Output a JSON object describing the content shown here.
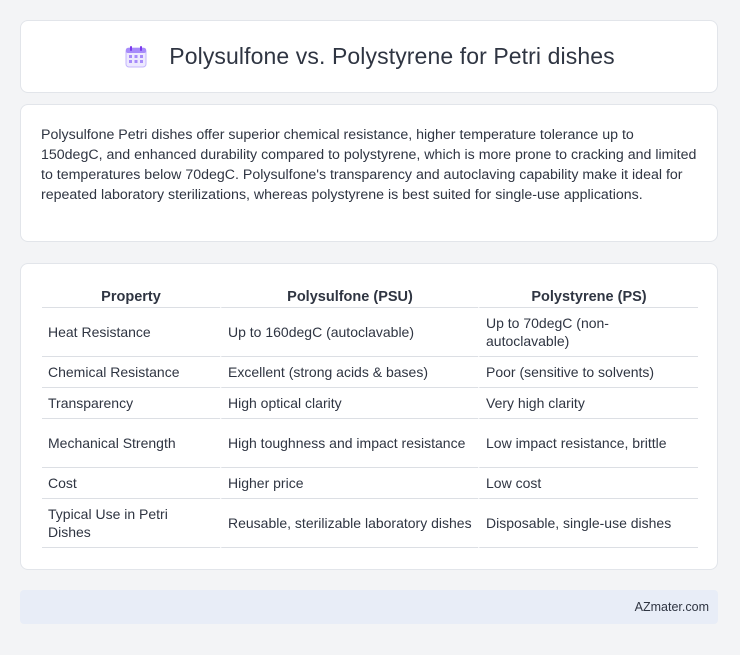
{
  "header": {
    "icon": "calendar-icon",
    "title": "Polysulfone vs. Polystyrene for Petri dishes"
  },
  "summary": {
    "text": "Polysulfone Petri dishes offer superior chemical resistance, higher temperature tolerance up to 150degC, and enhanced durability compared to polystyrene, which is more prone to cracking and limited to temperatures below 70degC. Polysulfone's transparency and autoclaving capability make it ideal for repeated laboratory sterilizations, whereas polystyrene is best suited for single-use applications."
  },
  "table": {
    "headers": [
      "Property",
      "Polysulfone (PSU)",
      "Polystyrene (PS)"
    ],
    "rows": [
      [
        "Heat Resistance",
        "Up to 160degC (autoclavable)",
        "Up to 70degC (non-autoclavable)"
      ],
      [
        "Chemical Resistance",
        "Excellent (strong acids & bases)",
        "Poor (sensitive to solvents)"
      ],
      [
        "Transparency",
        "High optical clarity",
        "Very high clarity"
      ],
      [
        "Mechanical Strength",
        "High toughness and impact resistance",
        "Low impact resistance, brittle"
      ],
      [
        "Cost",
        "Higher price",
        "Low cost"
      ],
      [
        "Typical Use in Petri Dishes",
        "Reusable, sterilizable laboratory dishes",
        "Disposable, single-use dishes"
      ]
    ]
  },
  "footer": {
    "text": "AZmater.com"
  },
  "colors": {
    "background": "#f3f4f6",
    "card": "#ffffff",
    "footer_bg": "#e8edf7",
    "icon_purple": "#a78bfa",
    "text": "#2f3542"
  }
}
